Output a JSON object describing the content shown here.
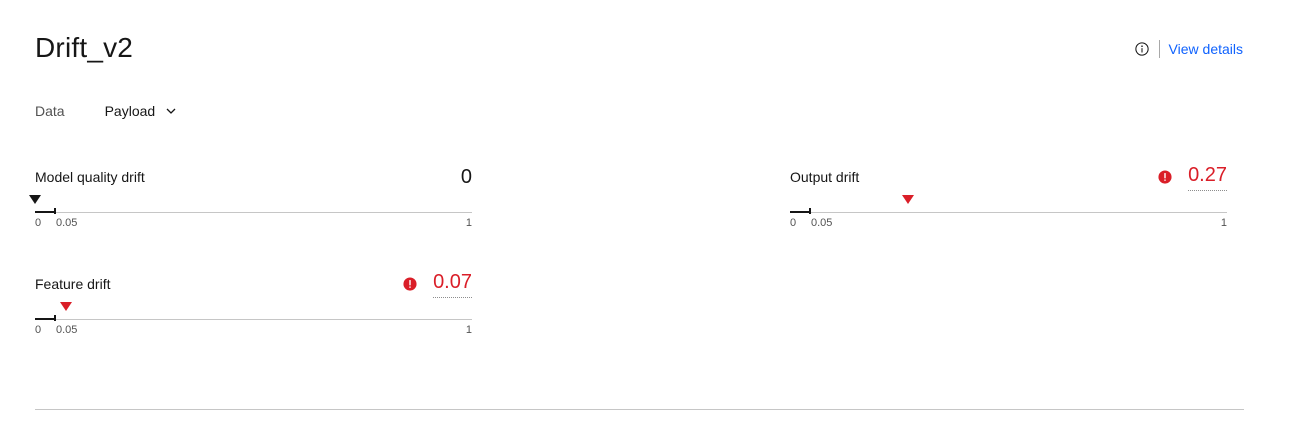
{
  "header": {
    "title": "Drift_v2",
    "info_icon": "info-icon",
    "view_details_label": "View details",
    "link_color": "#0f62fe"
  },
  "data_selector": {
    "label": "Data",
    "value": "Payload",
    "icon": "chevron-down-icon"
  },
  "metrics": {
    "model_quality": {
      "label": "Model quality drift",
      "value": "0",
      "alert": false,
      "scale": {
        "min": "0",
        "threshold": "0.05",
        "max": "1"
      },
      "marker_value": 0
    },
    "output": {
      "label": "Output drift",
      "value": "0.27",
      "alert": true,
      "scale": {
        "min": "0",
        "threshold": "0.05",
        "max": "1"
      },
      "marker_value": 0.27
    },
    "feature": {
      "label": "Feature drift",
      "value": "0.07",
      "alert": true,
      "scale": {
        "min": "0",
        "threshold": "0.05",
        "max": "1"
      },
      "marker_value": 0.07
    }
  },
  "colors": {
    "alert": "#da1e28",
    "text": "#161616",
    "muted": "#525252"
  }
}
